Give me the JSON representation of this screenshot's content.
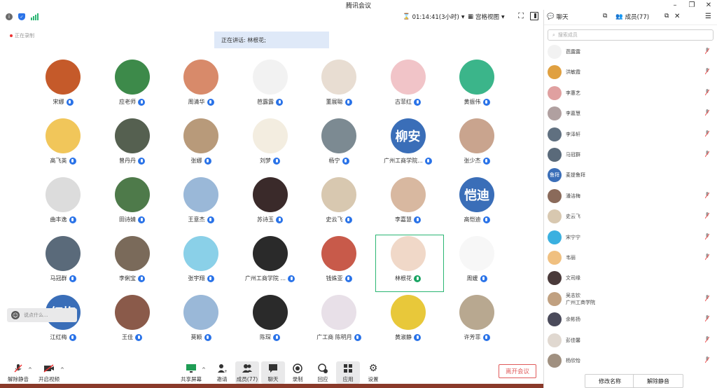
{
  "window": {
    "title": "腾讯会议"
  },
  "topbar": {
    "timer": "01:14:41(3小时)",
    "view_label": "宫格视图"
  },
  "recording_label": "正在录制",
  "speaker": {
    "label": "正在讲话: 林根花;"
  },
  "participants": [
    {
      "name": "宋娜",
      "color": "#c55a2a"
    },
    {
      "name": "应老师",
      "color": "#3d8a4a"
    },
    {
      "name": "周清华",
      "color": "#d88a6a"
    },
    {
      "name": "芭露露",
      "color": "#f2f2f2"
    },
    {
      "name": "董展聪",
      "color": "#e8ddd2"
    },
    {
      "name": "古菲红",
      "color": "#f1c4c8"
    },
    {
      "name": "黄振伟",
      "color": "#3bb58a"
    },
    {
      "name": "高飞英",
      "color": "#f1c65a"
    },
    {
      "name": "曾丹丹",
      "color": "#556050"
    },
    {
      "name": "张娜",
      "color": "#b89a7a"
    },
    {
      "name": "刘梦",
      "color": "#f3ede0"
    },
    {
      "name": "杨宁",
      "color": "#7c8a92"
    },
    {
      "name": "广州工商学院...",
      "color": "#3a6eb8",
      "text": "柳安"
    },
    {
      "name": "张少杰",
      "color": "#c9a48e"
    },
    {
      "name": "曲丰逸",
      "color": "#dcdcdc"
    },
    {
      "name": "田诗婧",
      "color": "#4e7a4a"
    },
    {
      "name": "王意杰",
      "color": "#9ab8d8"
    },
    {
      "name": "苏诗玉",
      "color": "#3a2a2a"
    },
    {
      "name": "史云飞",
      "color": "#d8c8b0"
    },
    {
      "name": "李嘉慧",
      "color": "#d8b8a0"
    },
    {
      "name": "高恺迪",
      "color": "#3a6eb8",
      "text": "恺迪"
    },
    {
      "name": "马冠群",
      "color": "#5a6a7a"
    },
    {
      "name": "李俐宝",
      "color": "#7a6a5a"
    },
    {
      "name": "张宇翔",
      "color": "#8ad0e8"
    },
    {
      "name": "广州工商学院 ...",
      "color": "#2a2a2a"
    },
    {
      "name": "钱姝亚",
      "color": "#c85a4a"
    },
    {
      "name": "林根花",
      "color": "#f0d8c8",
      "green": true
    },
    {
      "name": "周媛",
      "color": "#f7f7f7"
    },
    {
      "name": "江红梅",
      "color": "#3a6eb8",
      "text": "红梅"
    },
    {
      "name": "王佳",
      "color": "#8a5a4a"
    },
    {
      "name": "莫颖",
      "color": "#9ab8d8"
    },
    {
      "name": "陈琛",
      "color": "#2a2a2a"
    },
    {
      "name": "广工商 陈明月",
      "color": "#e8e0e8"
    },
    {
      "name": "黄淑静",
      "color": "#e8c83a"
    },
    {
      "name": "许芳菲",
      "color": "#b8a890"
    }
  ],
  "chat_input": {
    "placeholder": "说点什么..."
  },
  "bottombar": {
    "unmute": "解除静音",
    "video": "开启视频",
    "share": "共享屏幕",
    "invite": "邀请",
    "members": "成员(77)",
    "chat": "聊天",
    "record": "录制",
    "replay": "回应",
    "apps": "应用",
    "settings": "设置",
    "leave": "离开会议"
  },
  "panel": {
    "chat_tab": "聊天",
    "members_tab": "成员(77)",
    "search_placeholder": "搜索成员",
    "rename": "修改名称",
    "unmute": "解除静音",
    "members": [
      {
        "name": "芭露露",
        "color": "#f2f2f2"
      },
      {
        "name": "洪敏霞",
        "color": "#e0a040"
      },
      {
        "name": "李惠艺",
        "color": "#e0a0a0"
      },
      {
        "name": "李嘉慧",
        "color": "#b0a0a0"
      },
      {
        "name": "李泽轩",
        "color": "#607080"
      },
      {
        "name": "马冠群",
        "color": "#5a6a7a"
      },
      {
        "name": "麦提鲁拜",
        "color": "#3a6eb8",
        "text": "鲁拜"
      },
      {
        "name": "潘洁梅",
        "color": "#8a6a5a"
      },
      {
        "name": "史云飞",
        "color": "#d8c8b0"
      },
      {
        "name": "宋宁宁",
        "color": "#3ab0e0"
      },
      {
        "name": "韦丽",
        "color": "#f0c080"
      },
      {
        "name": "文司缘",
        "color": "#4a3a3a"
      },
      {
        "name": "吴志钦",
        "sub": "广州工商学院",
        "color": "#c0a080"
      },
      {
        "name": "余彬扬",
        "color": "#4a4a5a"
      },
      {
        "name": "彭佳馨",
        "color": "#e0d8d0"
      },
      {
        "name": "杨欣怡",
        "color": "#a09080"
      }
    ]
  }
}
